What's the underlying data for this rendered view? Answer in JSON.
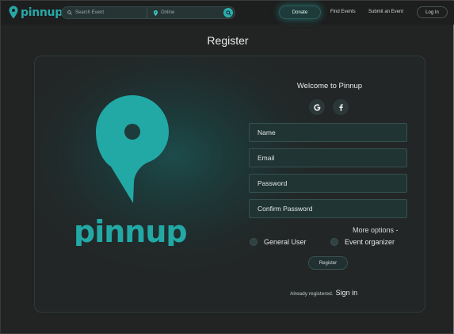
{
  "nav": {
    "brand": "pinnup",
    "search_placeholder": "Search Event",
    "location_value": "Online",
    "donate_label": "Donate",
    "find_events_label": "Find Events",
    "submit_event_label": "Submit an Event",
    "login_label": "Log In"
  },
  "page": {
    "title": "Register"
  },
  "card": {
    "logo_word": "pinnup",
    "welcome": "Welcome to Pinnup",
    "social": {
      "google_icon": "google-icon",
      "facebook_icon": "facebook-icon"
    },
    "fields": {
      "name_placeholder": "Name",
      "email_placeholder": "Email",
      "password_placeholder": "Password",
      "confirm_password_placeholder": "Confirm Password"
    },
    "more_options": "More options -",
    "roles": {
      "general_user": "General User",
      "event_organizer": "Event organizer"
    },
    "register_label": "Register",
    "already_registered": "Already registered.",
    "sign_in_label": "Sign in"
  },
  "colors": {
    "accent": "#27a8a6",
    "background": "#1f2020"
  }
}
